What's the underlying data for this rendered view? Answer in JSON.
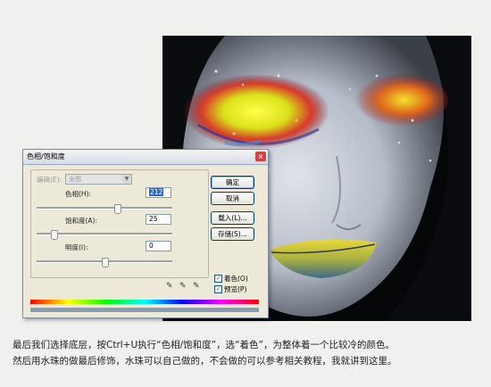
{
  "dialog": {
    "title": "色相/饱和度",
    "close": "×",
    "edit_label": "编辑(E):",
    "edit_value": "全图",
    "hue_label": "色相(H):",
    "hue_value": "212",
    "saturation_label": "饱和度(A):",
    "saturation_value": "25",
    "lightness_label": "明度(I):",
    "lightness_value": "0",
    "hue_level": 0.59,
    "saturation_level": 0.125,
    "lightness_level": 0.5,
    "buttons": {
      "ok": "确定",
      "cancel": "取消",
      "load": "载入(L)...",
      "save": "存储(S)..."
    },
    "colorize_label": "着色(O)",
    "colorize_checked": true,
    "preview_label": "预览(P)",
    "preview_checked": true,
    "colors": {
      "result_bar": "#8a9cb4",
      "button_border": "#003c74",
      "selection": "#316ac5"
    }
  },
  "caption": {
    "line1": "最后我们选择底层，按Ctrl+U执行“色相/饱和度”，选“着色”，为整体着一个比较冷的颜色。",
    "line2": "然后用水珠的做最后修饰，水珠可以自己做的，不会做的可以参考相关教程，我就讲到这里。"
  }
}
